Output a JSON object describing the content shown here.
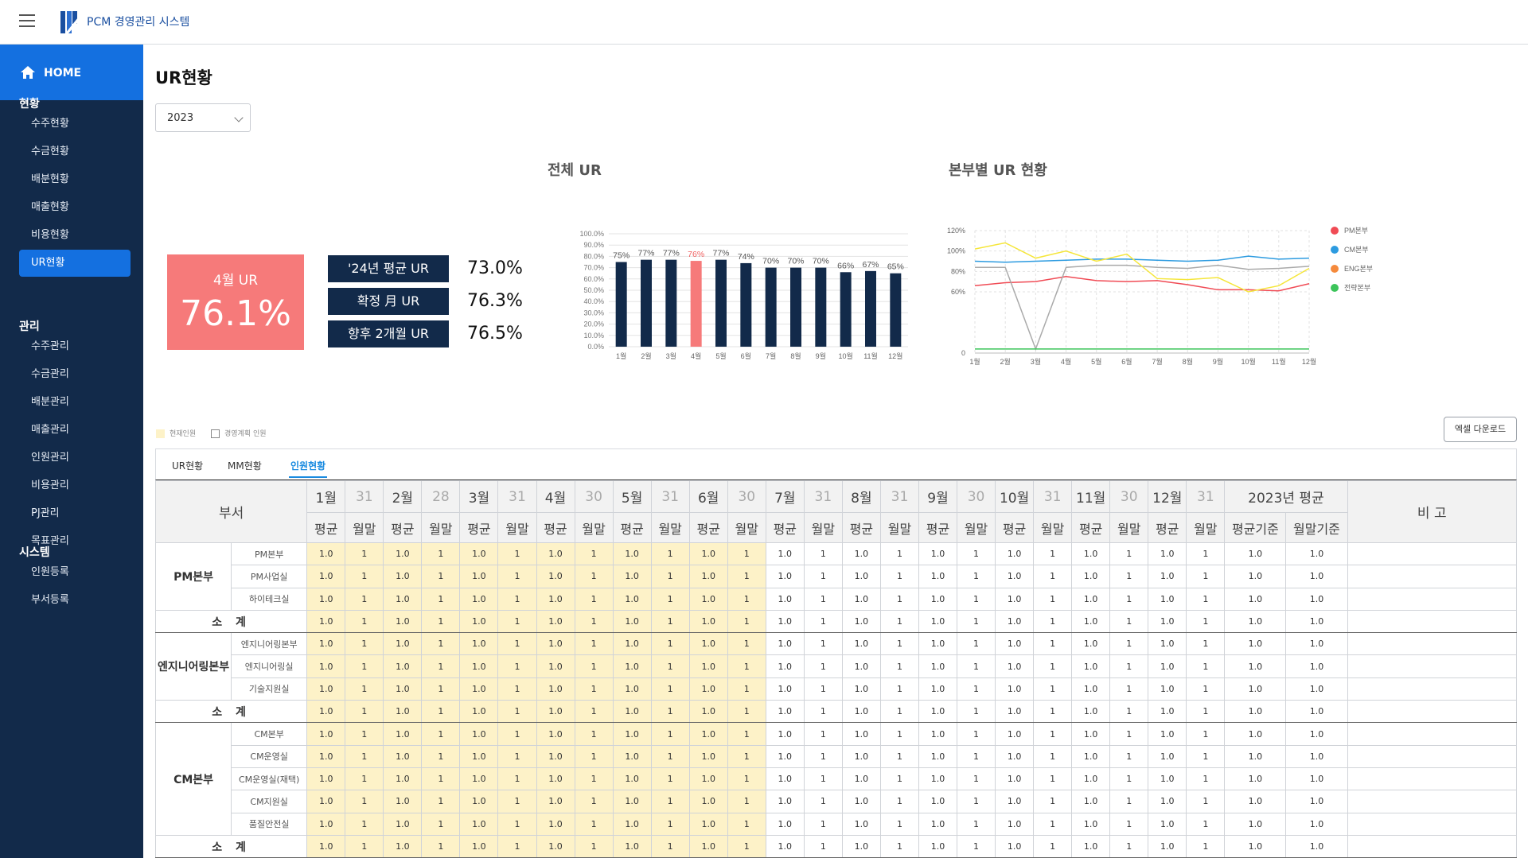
{
  "app": {
    "title": "PCM 경영관리 시스템"
  },
  "sidebar": {
    "home": "HOME",
    "sections": [
      {
        "title": "현황",
        "items": [
          "수주현황",
          "수금현황",
          "배분현황",
          "매출현황",
          "비용현황",
          "UR현황"
        ]
      },
      {
        "title": "관리",
        "items": [
          "수주관리",
          "수금관리",
          "배분관리",
          "매출관리",
          "인원관리",
          "비용관리",
          "PJ관리",
          "목표관리"
        ]
      },
      {
        "title": "시스템",
        "items": [
          "인원등록",
          "부서등록"
        ]
      }
    ],
    "active": "UR현황"
  },
  "page": {
    "title": "UR현황",
    "year": "2023"
  },
  "kpi": {
    "main_label": "4월 UR",
    "main_value": "76.1%",
    "rows": [
      {
        "label": "'24년 평균 UR",
        "value": "73.0%"
      },
      {
        "label": "확정 月 UR",
        "value": "76.3%"
      },
      {
        "label": "향후 2개월 UR",
        "value": "76.5%"
      }
    ]
  },
  "colors": {
    "navy": "#122a4a",
    "accent": "#1470e0",
    "highlight": "#f67a7a",
    "yellow_cell": "#fdf2c8"
  },
  "chart_data": [
    {
      "type": "bar",
      "title": "전체 UR",
      "categories": [
        "1월",
        "2월",
        "3월",
        "4월",
        "5월",
        "6월",
        "7월",
        "8월",
        "9월",
        "10월",
        "11월",
        "12월"
      ],
      "values": [
        75,
        77,
        77,
        76,
        77,
        74,
        70,
        70,
        70,
        66,
        67,
        65
      ],
      "data_labels": [
        "75%",
        "77%",
        "77%",
        "76%",
        "77%",
        "74%",
        "70%",
        "70%",
        "70%",
        "66%",
        "67%",
        "65%"
      ],
      "highlight_index": 3,
      "ylim": [
        0,
        100
      ],
      "yticks": [
        "0.0%",
        "10.0%",
        "20.0%",
        "30.0%",
        "40.0%",
        "50.0%",
        "60.0%",
        "70.0%",
        "80.0%",
        "90.0%",
        "100.0%"
      ],
      "grid": true
    },
    {
      "type": "line",
      "title": "본부별 UR 현황",
      "categories": [
        "1월",
        "2월",
        "3월",
        "4월",
        "5월",
        "6월",
        "7월",
        "8월",
        "9월",
        "10월",
        "11월",
        "12월"
      ],
      "ylim": [
        0,
        120
      ],
      "yticks": [
        "0",
        "60%",
        "80%",
        "100%",
        "120%"
      ],
      "legend": [
        "PM본부",
        "CM본부",
        "ENG본부",
        "전략본부"
      ],
      "legend_colors": [
        "#f04b55",
        "#2d9be0",
        "#f58a3c",
        "#3cc45a"
      ],
      "legend_position": "right",
      "grid": true,
      "series": [
        {
          "name": "PM본부",
          "color": "#f04b55",
          "values": [
            66,
            69,
            70,
            75,
            71,
            70,
            71,
            67,
            62,
            62,
            61,
            68
          ]
        },
        {
          "name": "CM본부",
          "color": "#2d9be0",
          "values": [
            90,
            89,
            90,
            91,
            92,
            92,
            91,
            90,
            91,
            95,
            92,
            93
          ]
        },
        {
          "series_color_note": "",
          "name": "",
          "color": "#aaaaaa",
          "values": [
            84,
            84,
            4,
            84,
            86,
            86,
            84,
            83,
            86,
            82,
            83,
            85
          ]
        },
        {
          "name": "",
          "color": "#f5e63a",
          "values": [
            102,
            108,
            93,
            100,
            90,
            97,
            73,
            72,
            74,
            60,
            66,
            83
          ]
        },
        {
          "name": "전략본부",
          "color": "#3cc45a",
          "values": [
            4,
            4,
            4,
            4,
            4,
            4,
            4,
            4,
            4,
            4,
            4,
            4
          ]
        }
      ]
    }
  ],
  "legend_mini": {
    "current": "현재인원",
    "plan": "경영계획 인원"
  },
  "excel_button": "엑셀 다운로드",
  "tabs": [
    "UR현황",
    "MM현황",
    "인원현황"
  ],
  "active_tab": "인원현황",
  "table": {
    "dept_header": "부서",
    "note_header": "비 고",
    "months": [
      {
        "label": "1월",
        "days": "31"
      },
      {
        "label": "2월",
        "days": "28"
      },
      {
        "label": "3월",
        "days": "31"
      },
      {
        "label": "4월",
        "days": "30"
      },
      {
        "label": "5월",
        "days": "31"
      },
      {
        "label": "6월",
        "days": "30"
      },
      {
        "label": "7월",
        "days": "31"
      },
      {
        "label": "8월",
        "days": "31"
      },
      {
        "label": "9월",
        "days": "30"
      },
      {
        "label": "10월",
        "days": "31"
      },
      {
        "label": "11월",
        "days": "30"
      },
      {
        "label": "12월",
        "days": "31"
      }
    ],
    "avg_header": "2023년 평균",
    "sub_avg": "평균",
    "sub_end": "월말",
    "sub_avg_basis": "평균기준",
    "sub_end_basis": "월말기준",
    "subtotal_label": "소 계",
    "cell_avg": "1.0",
    "cell_end": "1",
    "groups": [
      {
        "name": "PM본부",
        "rows": [
          "PM본부",
          "PM사업실",
          "하이테크실"
        ]
      },
      {
        "name": "엔지니어링본부",
        "rows": [
          "엔지니어링본부",
          "엔지니어링실",
          "기술지원실"
        ]
      },
      {
        "name": "CM본부",
        "rows": [
          "CM본부",
          "CM운영실",
          "CM운영실(재택)",
          "CM지원실",
          "품질안전실"
        ]
      }
    ]
  }
}
